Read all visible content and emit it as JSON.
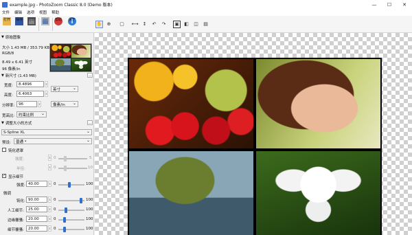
{
  "window": {
    "title": "example.jpg - PhotoZoom Classic 8.0 (Demo 版本)",
    "controls": [
      "—",
      "☐",
      "✕"
    ]
  },
  "menu": [
    "文件",
    "编辑",
    "选项",
    "视图",
    "帮助"
  ],
  "toolbar": {
    "buttons": [
      {
        "label": "打开",
        "icon": "folder-open-icon"
      },
      {
        "label": "保存",
        "icon": "save-icon"
      },
      {
        "label": "打印",
        "icon": "print-icon"
      },
      {
        "label": "预览",
        "icon": "preview-icon",
        "disabled": true
      },
      {
        "label": "帮助",
        "icon": "help-icon"
      },
      {
        "label": "关于",
        "icon": "about-icon",
        "glyph": "i"
      }
    ]
  },
  "view_tools": {
    "glyphs": [
      "✋",
      "⊕",
      "▢",
      "⟷",
      "↕",
      "↶",
      "↷",
      "▣",
      "◧",
      "◫",
      "▤"
    ]
  },
  "panel": {
    "original": {
      "header": "原始图像",
      "size_line": "大小 1.43 MB / 353.79 KB",
      "mode": "RGB/8",
      "dimensions": "8.49 x 6.41 英寸",
      "resolution": "96 像素/in"
    },
    "new_size": {
      "header": "新尺寸 (1.43 MB)",
      "width_label": "宽度:",
      "width_value": "8.4896",
      "height_label": "高度:",
      "height_value": "6.4063",
      "resolution_label": "分辨率:",
      "resolution_value": "96",
      "unit": "英寸",
      "res_unit": "像素/in",
      "aspect_label": "宽高比:",
      "aspect_value": "约束比例"
    },
    "resize": {
      "header": "调整大小的方式",
      "method": "S-Spline XL",
      "preset_label": "预设:",
      "preset_value": "普通 *",
      "sharpen_mask_label": "钝化遮罩",
      "strength_label": "强度:",
      "radius_label": "半径:",
      "slider_min": "0",
      "slider_max_5": "5",
      "slider_max_10": "10",
      "show_detail_label": "显示细节",
      "detail_strength_label": "强度:",
      "detail_strength_value": "40.00",
      "detail_strength_level": 0.4,
      "slider_max_100": "100",
      "fine_tune_label": "微调",
      "sharpen_label": "钝化:",
      "sharpen_value": "90.00",
      "sharpen_level": 0.9,
      "artificial_label": "人工细节:",
      "artificial_value": "25.00",
      "artificial_level": 0.25,
      "edge_label": "边缘覆骚:",
      "edge_value": "20.00",
      "edge_level": 0.2,
      "detail2_label": "细节覆骚:",
      "detail2_value": "20.00",
      "detail2_level": 0.2
    }
  },
  "canvas": {
    "photos": [
      "fruit-photo",
      "portrait-photo",
      "frog-photo",
      "lily-photo"
    ]
  }
}
